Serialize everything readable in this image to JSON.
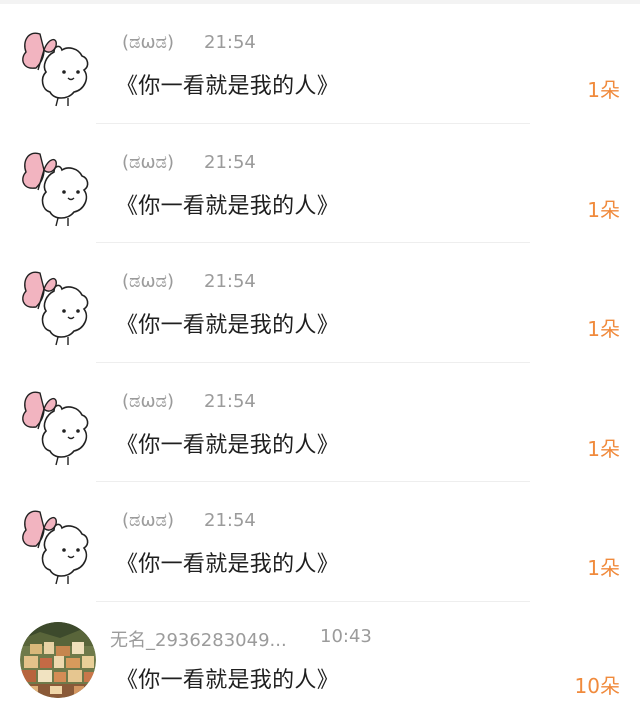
{
  "comments": [
    {
      "name": "(ಡωಡ)",
      "time": "21:54",
      "message": "《你一看就是我的人》",
      "gift": "1朵",
      "avatar": "butterfly-bear-icon"
    },
    {
      "name": "(ಡωಡ)",
      "time": "21:54",
      "message": "《你一看就是我的人》",
      "gift": "1朵",
      "avatar": "butterfly-bear-icon"
    },
    {
      "name": "(ಡωಡ)",
      "time": "21:54",
      "message": "《你一看就是我的人》",
      "gift": "1朵",
      "avatar": "butterfly-bear-icon"
    },
    {
      "name": "(ಡωಡ)",
      "time": "21:54",
      "message": "《你一看就是我的人》",
      "gift": "1朵",
      "avatar": "butterfly-bear-icon"
    },
    {
      "name": "(ಡωಡ)",
      "time": "21:54",
      "message": "《你一看就是我的人》",
      "gift": "1朵",
      "avatar": "butterfly-bear-icon"
    },
    {
      "name": "无名_2936283049...",
      "time": "10:43",
      "message": "《你一看就是我的人》",
      "gift": "10朵",
      "avatar": "town-photo-avatar"
    }
  ],
  "colors": {
    "gift": "#f08a3c",
    "meta": "#9b9b9b",
    "text": "#1f1f1f",
    "butterfly": "#f2b4c0"
  }
}
